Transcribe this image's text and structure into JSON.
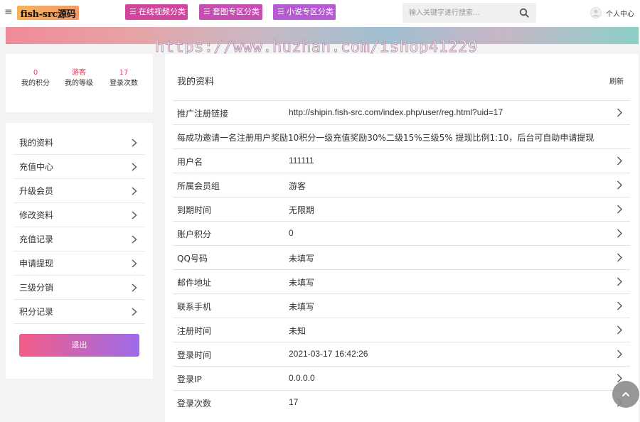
{
  "header": {
    "logo_text": "fish-src源码",
    "nav": [
      {
        "label": "在线视频分类"
      },
      {
        "label": "套图专区分类"
      },
      {
        "label": "小说专区分类"
      }
    ],
    "search_placeholder": "输入关键字进行搜索...",
    "user_label": "个人中心"
  },
  "watermark": "https://www.huzhan.com/ishop41229",
  "stats": [
    {
      "value": "0",
      "label": "我的积分"
    },
    {
      "value": "游客",
      "label": "我的等级"
    },
    {
      "value": "17",
      "label": "登录次数"
    }
  ],
  "menu": {
    "items": [
      {
        "label": "我的资料"
      },
      {
        "label": "充值中心"
      },
      {
        "label": "升级会员"
      },
      {
        "label": "修改资料"
      },
      {
        "label": "充值记录"
      },
      {
        "label": "申请提现"
      },
      {
        "label": "三级分销"
      },
      {
        "label": "积分记录"
      }
    ],
    "logout_label": "退出"
  },
  "main": {
    "title": "我的资料",
    "refresh_label": "刷新",
    "promo": {
      "key": "推广注册链接",
      "value": "http://shipin.fish-src.com/index.php/user/reg.html?uid=17"
    },
    "note": "每成功邀请一名注册用户奖励10积分一级充值奖励30%二级15%三级5% 提现比例1:10，后台可自助申请提现",
    "fields": [
      {
        "key": "用户名",
        "value": "111111"
      },
      {
        "key": "所属会员组",
        "value": "游客"
      },
      {
        "key": "到期时间",
        "value": "无限期"
      },
      {
        "key": "账户积分",
        "value": "0"
      },
      {
        "key": "QQ号码",
        "value": "未填写"
      },
      {
        "key": "邮件地址",
        "value": "未填写"
      },
      {
        "key": "联系手机",
        "value": "未填写"
      },
      {
        "key": "注册时间",
        "value": "未知"
      },
      {
        "key": "登录时间",
        "value": "2021-03-17 16:42:26"
      },
      {
        "key": "登录IP",
        "value": "0.0.0.0"
      },
      {
        "key": "登录次数",
        "value": "17"
      }
    ]
  },
  "colors": {
    "accent": "#e4405f",
    "nav_pink": "#d0459d",
    "nav_purple": "#b55ad2",
    "logout_start": "#f35d86",
    "logout_end": "#9d6bea"
  },
  "icons": {
    "menu": "hamburger-icon",
    "nav": "list-icon",
    "search": "search-icon",
    "user": "user-avatar-icon",
    "row": "chevron-right-icon",
    "scroll": "arrow-up-icon"
  }
}
